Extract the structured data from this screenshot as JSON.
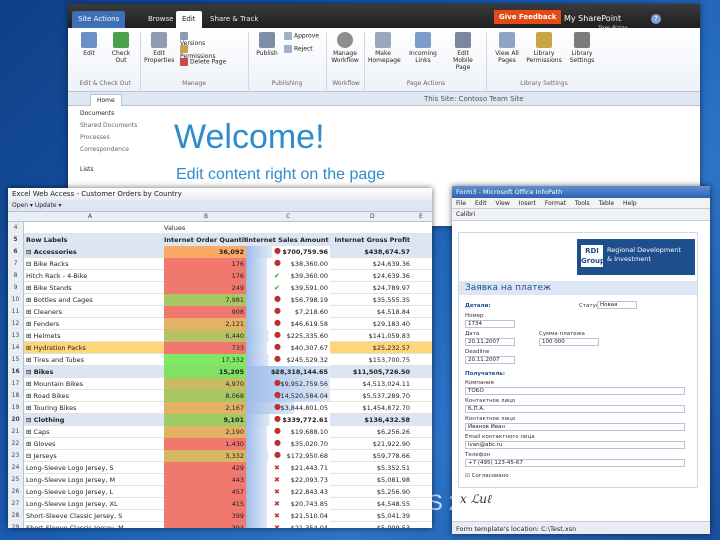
{
  "background": {
    "year_fragment": "10",
    "bottom_fragment": "S 2"
  },
  "sharepoint": {
    "tabs": [
      "Site Actions",
      "Browse",
      "Edit",
      "Share & Track"
    ],
    "give_feedback": "Give Feedback",
    "my_sharepoint": "My SharePoint",
    "user": "Tom Rizzo",
    "ribbon": {
      "big": [
        {
          "label": "Edit",
          "icon": "edit-page-icon"
        },
        {
          "label": "Check Out",
          "icon": "check-out-icon"
        },
        {
          "label": "Edit Properties",
          "icon": "edit-properties-icon"
        },
        {
          "label": "Publish",
          "icon": "publish-icon"
        },
        {
          "label": "Manage Workflow",
          "icon": "workflow-icon"
        },
        {
          "label": "Make Homepage",
          "icon": "make-homepage-icon"
        },
        {
          "label": "Incoming Links",
          "icon": "incoming-links-icon"
        },
        {
          "label": "Edit Mobile Page",
          "icon": "mobile-page-icon"
        },
        {
          "label": "View All Pages",
          "icon": "view-all-pages-icon"
        },
        {
          "label": "Library Permissions",
          "icon": "library-permissions-icon"
        },
        {
          "label": "Library Settings",
          "icon": "library-settings-icon"
        }
      ],
      "small_manage": [
        "Versions",
        "Permissions",
        "Delete Page"
      ],
      "small_publish": [
        "Approve",
        "Reject"
      ],
      "groups": [
        "Edit & Check Out",
        "Manage",
        "Publishing",
        "Workflow",
        "Page Actions",
        "Library Settings"
      ]
    },
    "home_tab": "Home",
    "site_title": "This Site: Contoso Team Site",
    "left_nav": [
      "Documents",
      "Shared Documents",
      "Processes",
      "Correspondence",
      "",
      "Lists"
    ],
    "welcome": "Welcome!",
    "subtitle": "Edit content right on the page"
  },
  "excel": {
    "title": "Excel Web Access - Customer Orders by Country",
    "toolbar": "Open ▾   Update ▾",
    "columns": [
      "A",
      "B",
      "C",
      "D",
      "E"
    ],
    "values_label": "Values",
    "headers": [
      "Row Labels",
      "Internet Order Quantity",
      "Internet Sales Amount",
      "Internet Gross Profit"
    ],
    "rows": [
      {
        "n": "6",
        "label": "⊟ Accessories",
        "q": "36,092",
        "s": "$700,759.96",
        "p": "$438,674.57",
        "mark": "dot",
        "type": "cat"
      },
      {
        "n": "7",
        "label": "  ⊟ Bike Racks",
        "q": "176",
        "s": "$38,360.00",
        "p": "$24,639.36",
        "mark": "dot"
      },
      {
        "n": "8",
        "label": "      Hitch Rack - 4-Bike",
        "q": "176",
        "s": "$39,360.00",
        "p": "$24,639.36",
        "mark": "ok"
      },
      {
        "n": "9",
        "label": "  ⊞ Bike Stands",
        "q": "249",
        "s": "$39,591.00",
        "p": "$24,789.97",
        "mark": "ok"
      },
      {
        "n": "10",
        "label": "  ⊞ Bottles and Cages",
        "q": "7,981",
        "s": "$56,798.19",
        "p": "$35,555.35",
        "mark": "dot"
      },
      {
        "n": "11",
        "label": "  ⊞ Cleaners",
        "q": "908",
        "s": "$7,218.60",
        "p": "$4,518.84",
        "mark": "dot"
      },
      {
        "n": "12",
        "label": "  ⊞ Fenders",
        "q": "2,121",
        "s": "$46,619.58",
        "p": "$29,183.40",
        "mark": "dot"
      },
      {
        "n": "13",
        "label": "  ⊞ Helmets",
        "q": "6,440",
        "s": "$225,335.60",
        "p": "$141,059.83",
        "mark": "dot"
      },
      {
        "n": "14",
        "label": "  ⊞ Hydration Packs",
        "q": "733",
        "s": "$40,307.67",
        "p": "$25,232.57",
        "mark": "dot",
        "type": "sel"
      },
      {
        "n": "15",
        "label": "  ⊞ Tires and Tubes",
        "q": "17,332",
        "s": "$245,529.32",
        "p": "$153,700.75",
        "mark": "dot"
      },
      {
        "n": "16",
        "label": "⊟ Bikes",
        "q": "15,205",
        "s": "$28,318,144.65",
        "p": "$11,505,726.50",
        "mark": "ok",
        "type": "cat"
      },
      {
        "n": "17",
        "label": "  ⊞ Mountain Bikes",
        "q": "4,970",
        "s": "$9,952,759.56",
        "p": "$4,513,024.11",
        "mark": "dot"
      },
      {
        "n": "18",
        "label": "  ⊞ Road Bikes",
        "q": "8,068",
        "s": "$14,520,584.04",
        "p": "$5,537,289.70",
        "mark": "dot"
      },
      {
        "n": "19",
        "label": "  ⊞ Touring Bikes",
        "q": "2,167",
        "s": "$3,844,801.05",
        "p": "$1,454,872.70",
        "mark": "dot"
      },
      {
        "n": "20",
        "label": "⊟ Clothing",
        "q": "9,101",
        "s": "$339,772.61",
        "p": "$136,432.58",
        "mark": "dot",
        "type": "cat"
      },
      {
        "n": "21",
        "label": "  ⊞ Caps",
        "q": "2,190",
        "s": "$19,688.10",
        "p": "$6,256.26",
        "mark": "dot"
      },
      {
        "n": "22",
        "label": "  ⊞ Gloves",
        "q": "1,430",
        "s": "$35,020.70",
        "p": "$21,922.90",
        "mark": "dot"
      },
      {
        "n": "23",
        "label": "  ⊟ Jerseys",
        "q": "3,332",
        "s": "$172,950.68",
        "p": "$59,778.66",
        "mark": "dot"
      },
      {
        "n": "24",
        "label": "      Long-Sleeve Logo Jersey, S",
        "q": "429",
        "s": "$21,443.71",
        "p": "$5,352.51",
        "mark": "x"
      },
      {
        "n": "25",
        "label": "      Long-Sleeve Logo Jersey, M",
        "q": "443",
        "s": "$22,093.73",
        "p": "$5,081.98",
        "mark": "x"
      },
      {
        "n": "26",
        "label": "      Long-Sleeve Logo Jersey, L",
        "q": "457",
        "s": "$22,843.43",
        "p": "$5,256.90",
        "mark": "x"
      },
      {
        "n": "27",
        "label": "      Long-Sleeve Logo Jersey, XL",
        "q": "415",
        "s": "$20,743.85",
        "p": "$4,548.55",
        "mark": "x"
      },
      {
        "n": "28",
        "label": "      Short-Sleeve Classic Jersey, S",
        "q": "399",
        "s": "$21,510.04",
        "p": "$5,041.39",
        "mark": "x"
      },
      {
        "n": "29",
        "label": "      Short-Sleeve Classic Jersey, M",
        "q": "394",
        "s": "$21,354.04",
        "p": "$5,009.53",
        "mark": "x"
      },
      {
        "n": "30",
        "label": "      Short-Sleeve Classic Jersey, L",
        "q": "374",
        "s": "$20,170.26",
        "p": "$4,644.32",
        "mark": "x"
      }
    ]
  },
  "infopath": {
    "title": "Form3 - Microsoft Office InfoPath",
    "menu": [
      "File",
      "Edit",
      "View",
      "Insert",
      "Format",
      "Tools",
      "Table",
      "Help"
    ],
    "font": "Calibri",
    "logo_mark": "RDI Group",
    "logo_text": [
      "Regional Development",
      "& Investment"
    ],
    "heading": "Заявка на платеж",
    "details_label": "Детали:",
    "fields": [
      {
        "label": "Номер",
        "value": "1734"
      },
      {
        "label": "Дата",
        "value": "20.11.2007"
      },
      {
        "label": "Сумма платежа",
        "value": "100 000"
      },
      {
        "label": "Deadline",
        "value": "20.11.2007"
      }
    ],
    "status_label": "Статус",
    "status_value": "Новая",
    "recipients_label": "Получатель:",
    "recipient_fields": [
      {
        "label": "Компания",
        "value": "ТОБО"
      },
      {
        "label": "Контактное лицо",
        "value": "Б.П.А."
      },
      {
        "label": "Контактное лицо",
        "value": "Иванов Иван"
      },
      {
        "label": "Email контактного лица",
        "value": "ivan@abc.ru"
      },
      {
        "label": "Телефон",
        "value": "+7 (495) 123-45-67"
      }
    ],
    "checkbox": "Согласовано",
    "signature": "x  ℒuℓ",
    "status_bar": "Form template's location: C:\\Test.xsn"
  },
  "colors": {
    "accent": "#2d8ccd",
    "excel_header": "#dbe5f3",
    "feedback": "#e24a16",
    "infopath_title": "#2e63b4"
  }
}
